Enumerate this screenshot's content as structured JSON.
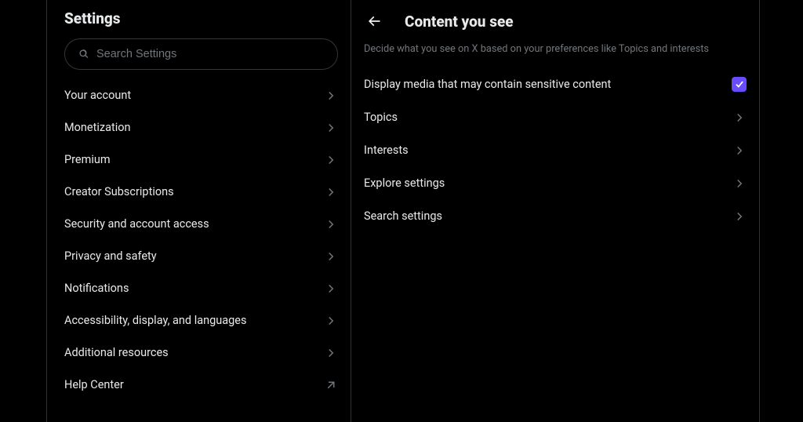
{
  "sidebar": {
    "title": "Settings",
    "search_placeholder": "Search Settings",
    "items": [
      {
        "label": "Your account",
        "external": false
      },
      {
        "label": "Monetization",
        "external": false
      },
      {
        "label": "Premium",
        "external": false
      },
      {
        "label": "Creator Subscriptions",
        "external": false
      },
      {
        "label": "Security and account access",
        "external": false
      },
      {
        "label": "Privacy and safety",
        "external": false
      },
      {
        "label": "Notifications",
        "external": false
      },
      {
        "label": "Accessibility, display, and languages",
        "external": false
      },
      {
        "label": "Additional resources",
        "external": false
      },
      {
        "label": "Help Center",
        "external": true
      }
    ]
  },
  "content": {
    "title": "Content you see",
    "description": "Decide what you see on X based on your preferences like Topics and interests",
    "sensitive_toggle_label": "Display media that may contain sensitive content",
    "sensitive_toggle_checked": true,
    "rows": [
      {
        "label": "Topics"
      },
      {
        "label": "Interests"
      },
      {
        "label": "Explore settings"
      },
      {
        "label": "Search settings"
      }
    ]
  }
}
